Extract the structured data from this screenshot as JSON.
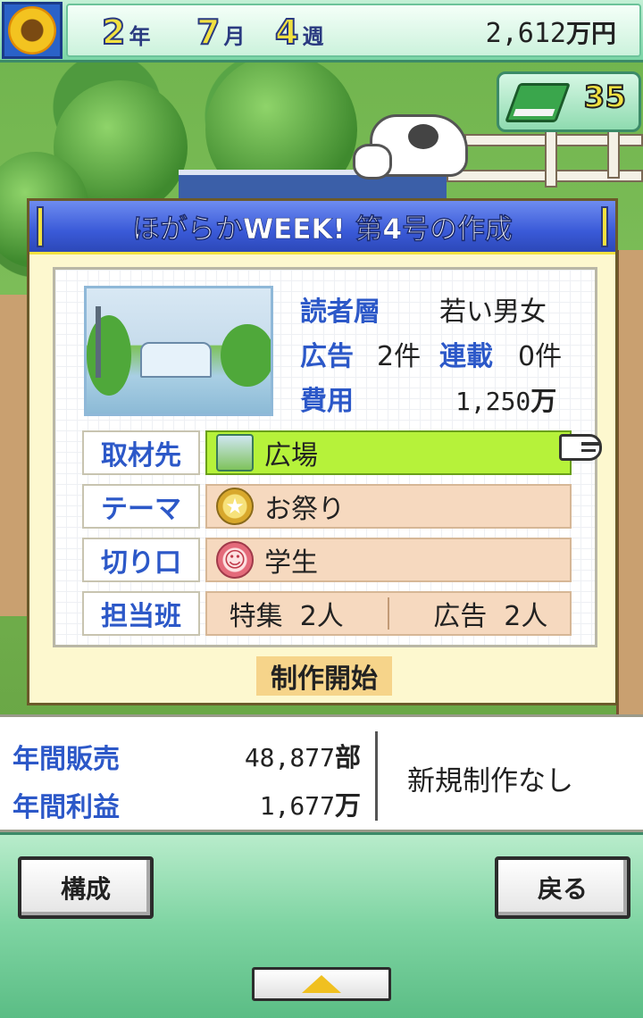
{
  "header": {
    "year": "2",
    "year_unit": "年",
    "month": "7",
    "month_unit": "月",
    "week": "4",
    "week_unit": "週",
    "money": "2,612",
    "money_unit": "万円"
  },
  "book_counter": {
    "count": "35",
    "icon": "book-icon"
  },
  "dialog": {
    "title": "ほがらかWEEK! 第4号の作成",
    "readers_label": "読者層",
    "readers_value": "若い男女",
    "ads_label": "広告",
    "ads_value": "2件",
    "serial_label": "連載",
    "serial_value": "0件",
    "cost_label": "費用",
    "cost_value": "1,250",
    "cost_unit": "万",
    "rows": {
      "location": {
        "label": "取材先",
        "value": "広場",
        "icon": "plaza-icon"
      },
      "theme": {
        "label": "テーマ",
        "value": "お祭り",
        "icon": "star-medal-icon"
      },
      "angle": {
        "label": "切り口",
        "value": "学生",
        "icon": "student-icon"
      },
      "team": {
        "label": "担当班",
        "feature_label": "特集",
        "feature_count": "2人",
        "ad_label": "広告",
        "ad_count": "2人"
      }
    },
    "start_label": "制作開始"
  },
  "stats": {
    "sales_label": "年間販売",
    "sales_value": "48,877",
    "sales_unit": "部",
    "profit_label": "年間利益",
    "profit_value": "1,677",
    "profit_unit": "万",
    "status": "新規制作なし"
  },
  "footer": {
    "compose_label": "構成",
    "back_label": "戻る"
  }
}
